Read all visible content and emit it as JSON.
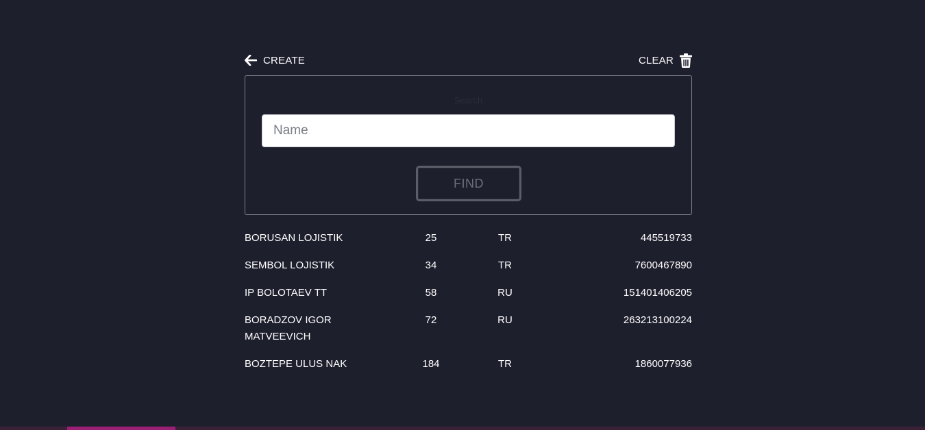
{
  "toolbar": {
    "create_label": "CREATE",
    "create_icon": "arrow-left-icon",
    "clear_label": "CLEAR",
    "clear_icon": "trash-icon"
  },
  "search_panel": {
    "title": "Search",
    "name_input": {
      "placeholder": "Name",
      "value": ""
    },
    "find_label": "FIND"
  },
  "results": [
    {
      "name": "BORUSAN LOJISTIK",
      "number": "25",
      "country": "TR",
      "id": "445519733"
    },
    {
      "name": "SEMBOL LOJISTIK",
      "number": "34",
      "country": "TR",
      "id": "7600467890"
    },
    {
      "name": "IP BOLOTAEV TT",
      "number": "58",
      "country": "RU",
      "id": "151401406205"
    },
    {
      "name": "BORADZOV IGOR MATVEEVICH",
      "number": "72",
      "country": "RU",
      "id": "263213100224"
    },
    {
      "name": "BOZTEPE ULUS NAK",
      "number": "184",
      "country": "TR",
      "id": "1860077936"
    }
  ],
  "colors": {
    "background": "#1e1f2d",
    "accent": "#9b1f74"
  }
}
